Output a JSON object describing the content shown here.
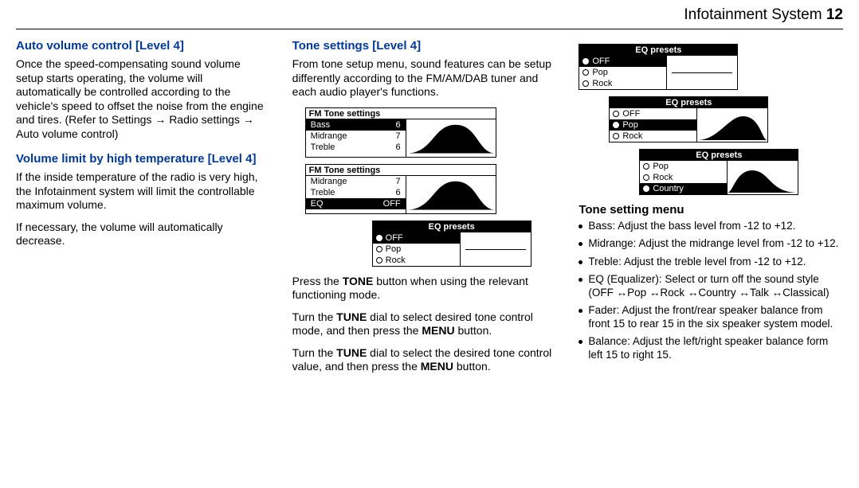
{
  "header": {
    "title": "Infotainment System",
    "page": "12"
  },
  "col1": {
    "h_auto": "Auto volume control [Level 4]",
    "p_auto": "Once the speed-compensating sound volume setup starts operating, the volume will automatically be controlled according to the vehicle's speed to offset the noise from the engine and tires. (Refer to Settings → Radio settings → Auto volume control)",
    "h_vol": "Volume limit by high temperature [Level 4]",
    "p_vol1": "If the inside temperature of the radio is very high, the Infotainment system will limit the controllable maximum volume.",
    "p_vol2": "If necessary, the volume will automatically decrease."
  },
  "col2": {
    "h_tone": "Tone settings [Level 4]",
    "p_tone1": "From tone setup menu, sound features can be setup differently according to the FM/AM/DAB tuner and each audio player's functions.",
    "fig_fm1": {
      "title": "FM Tone settings",
      "rows": [
        {
          "label": "Bass",
          "val": "6",
          "sel": true
        },
        {
          "label": "Midrange",
          "val": "7",
          "sel": false
        },
        {
          "label": "Treble",
          "val": "6",
          "sel": false
        }
      ]
    },
    "fig_fm2": {
      "title": "FM Tone settings",
      "rows": [
        {
          "label": "Midrange",
          "val": "7",
          "sel": false
        },
        {
          "label": "Treble",
          "val": "6",
          "sel": false
        },
        {
          "label": "EQ",
          "val": "OFF",
          "sel": true
        }
      ]
    },
    "fig_eq": {
      "title": "EQ presets",
      "opts": [
        {
          "label": "OFF",
          "on": true,
          "sel": true
        },
        {
          "label": "Pop",
          "on": false,
          "sel": false
        },
        {
          "label": "Rock",
          "on": false,
          "sel": false
        }
      ],
      "curve": "flat"
    },
    "p_tone2_a": "Press the ",
    "p_tone2_b": "TONE",
    "p_tone2_c": " button when using the relevant functioning mode.",
    "p_tone3_a": "Turn the ",
    "p_tone3_b": "TUNE",
    "p_tone3_c": " dial to select desired tone control mode, and then press the ",
    "p_tone3_d": "MENU",
    "p_tone3_e": " button.",
    "p_tone4_a": "Turn the ",
    "p_tone4_b": "TUNE",
    "p_tone4_c": " dial to select the desired tone control value, and then press the ",
    "p_tone4_d": "MENU",
    "p_tone4_e": " button."
  },
  "col3": {
    "fig_eq0": {
      "title": "EQ presets",
      "opts": [
        {
          "label": "OFF",
          "on": true,
          "sel": true
        },
        {
          "label": "Pop",
          "on": false,
          "sel": false
        },
        {
          "label": "Rock",
          "on": false,
          "sel": false
        }
      ],
      "curve": "flat"
    },
    "fig_eq1": {
      "title": "EQ presets",
      "opts": [
        {
          "label": "OFF",
          "on": false,
          "sel": false
        },
        {
          "label": "Pop",
          "on": true,
          "sel": true
        },
        {
          "label": "Rock",
          "on": false,
          "sel": false
        }
      ],
      "curve": "pop"
    },
    "fig_eq2": {
      "title": "EQ presets",
      "opts": [
        {
          "label": "Pop",
          "on": false,
          "sel": false
        },
        {
          "label": "Rock",
          "on": false,
          "sel": false
        },
        {
          "label": "Country",
          "on": true,
          "sel": true
        }
      ],
      "curve": "country"
    },
    "sub": "Tone setting menu",
    "list": [
      "Bass: Adjust the bass level from -12 to +12.",
      "Midrange: Adjust the midrange level from -12 to +12.",
      "Treble: Adjust the treble level from -12 to +12.",
      "EQ (Equalizer): Select or turn off the sound style (OFF ↔Pop ↔Rock ↔Country ↔Talk ↔Classical)",
      "Fader: Adjust the front/rear speaker balance from front 15 to rear 15 in the six speaker system model.",
      "Balance: Adjust the left/right speaker balance form left 15 to right 15."
    ]
  }
}
